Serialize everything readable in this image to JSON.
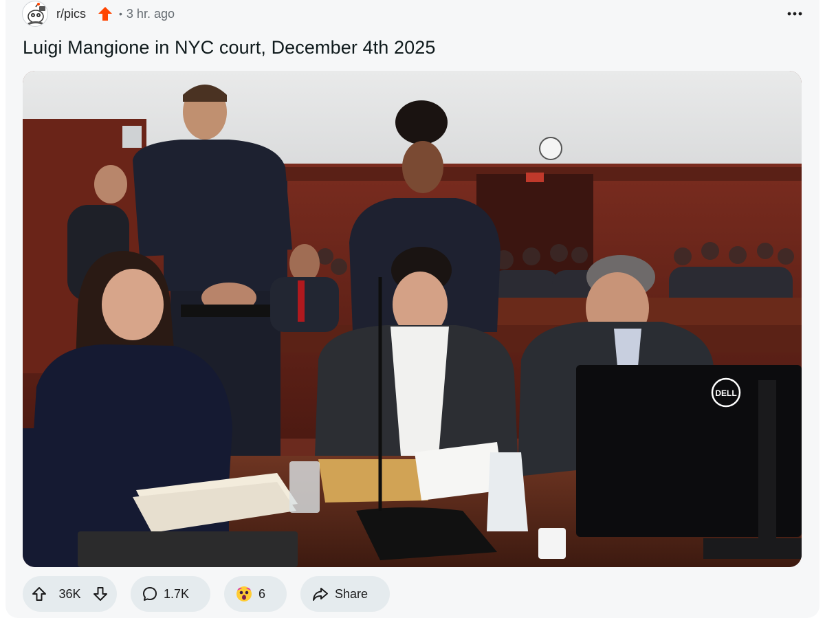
{
  "post": {
    "subreddit": "r/pics",
    "separator": "•",
    "time_ago": "3 hr. ago",
    "title": "Luigi Mangione in NYC court, December 4th 2025",
    "image_alt": "Courtroom photo with officers standing behind seated people at a defense table",
    "monitor_brand": "DELL"
  },
  "actions": {
    "upvotes": "36K",
    "comments": "1.7K",
    "awards": "6",
    "share_label": "Share"
  },
  "icons": {
    "upvote": "arrow-up-icon",
    "downvote": "arrow-down-icon",
    "comment": "comment-bubble-icon",
    "award": "shocked-face-award-icon",
    "share": "share-arrow-icon",
    "more": "more-dots-icon",
    "trending": "orange-up-arrow-icon"
  },
  "colors": {
    "accent_orange": "#ff4500",
    "pill_bg": "#e5ebee",
    "card_bg": "#f6f7f8"
  }
}
